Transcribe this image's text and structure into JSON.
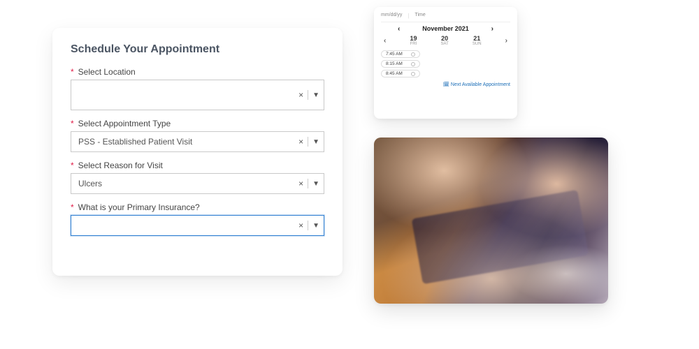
{
  "form": {
    "title": "Schedule Your Appointment",
    "fields": {
      "location": {
        "label": "Select Location",
        "value": ""
      },
      "apptType": {
        "label": "Select Appointment Type",
        "value": "PSS - Established Patient Visit"
      },
      "reason": {
        "label": "Select Reason for Visit",
        "value": "Ulcers"
      },
      "insurance": {
        "label": "What is your Primary Insurance?",
        "value": ""
      }
    },
    "icons": {
      "clear": "×",
      "chevron": "▼",
      "required": "*"
    }
  },
  "calendar": {
    "datePlaceholder": "mm/dd/yy",
    "timePlaceholder": "Time",
    "monthLabel": "November 2021",
    "days": [
      {
        "num": "19",
        "dow": "FRI"
      },
      {
        "num": "20",
        "dow": "SAT"
      },
      {
        "num": "21",
        "dow": "SUN"
      }
    ],
    "slots": [
      "7:45 AM",
      "8:15 AM",
      "8:45 AM"
    ],
    "nextLink": "Next Available Appointment",
    "nav": {
      "prev": "‹",
      "next": "›"
    },
    "linkIcon": "🗓"
  }
}
